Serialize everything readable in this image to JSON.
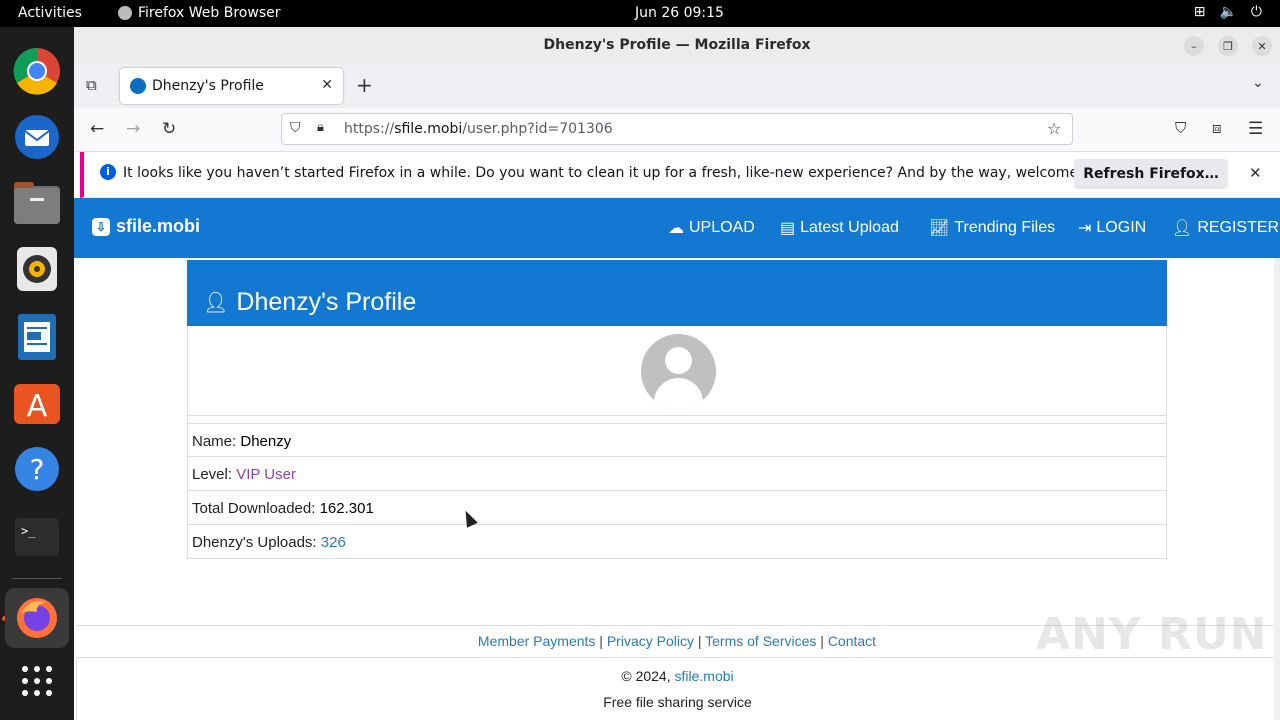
{
  "topbar": {
    "activities": "Activities",
    "app_name": "Firefox Web Browser",
    "clock": "Jun 26  09:15"
  },
  "dock": {
    "items": [
      "chrome-icon",
      "thunderbird-icon",
      "files-icon",
      "rhythmbox-icon",
      "writer-icon",
      "app-center-icon",
      "help-icon",
      "terminal-icon",
      "firefox-icon",
      "app-grid-icon"
    ]
  },
  "window": {
    "title": "Dhenzy's Profile — Mozilla Firefox"
  },
  "tab": {
    "label": "Dhenzy's Profile"
  },
  "urlbar": {
    "prefix": "https://",
    "domain": "sfile.mobi",
    "path": "/user.php?id=701306"
  },
  "notification": {
    "message": "It looks like you haven’t started Firefox in a while. Do you want to clean it up for a fresh, like-new experience? And by the way, welcome back!",
    "button": "Refresh Firefox…"
  },
  "site": {
    "brand": "sfile.mobi",
    "menu": {
      "upload": "UPLOAD",
      "latest": "Latest Upload",
      "trending": "Trending Files",
      "login": "LOGIN",
      "register": "REGISTER"
    }
  },
  "profile": {
    "heading": "Dhenzy's Profile",
    "name_label": "Name:",
    "name_value": "Dhenzy",
    "level_label": "Level:",
    "level_value": "VIP User",
    "downloaded_label": "Total Downloaded:",
    "downloaded_value": "162.301",
    "uploads_label": "Dhenzy's Uploads:",
    "uploads_value": "326"
  },
  "footer": {
    "links": [
      "Member Payments",
      "Privacy Policy",
      "Terms of Services",
      "Contact"
    ],
    "copyright": "© 2024,",
    "site_link": "sfile.mobi",
    "tagline": "Free file sharing service"
  },
  "watermark": "ANY RUN"
}
